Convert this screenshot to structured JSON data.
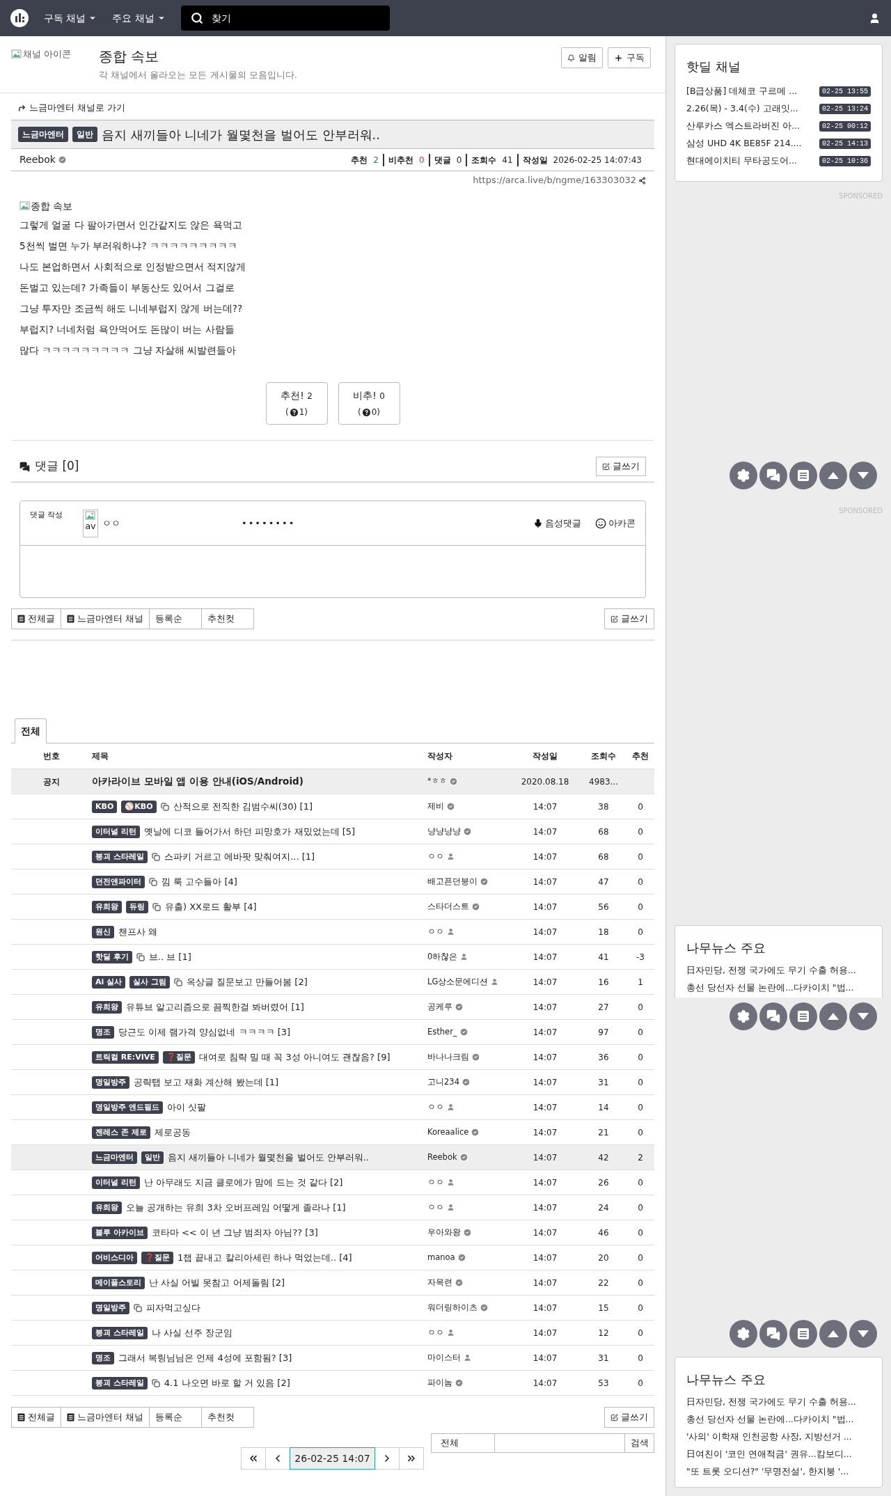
{
  "top_nav": {
    "menus": [
      {
        "label": "구독 채널"
      },
      {
        "label": "주요 채널"
      }
    ],
    "search": {
      "placeholder": "찾기"
    }
  },
  "channel": {
    "icon_alt": "채널 아이콘",
    "title": "종합 속보",
    "description": "각 채널에서 올라오는 모든 게시물의 모음입니다.",
    "buttons": [
      {
        "kind": "bell",
        "label": "알림"
      },
      {
        "kind": "plus",
        "label": "구독"
      }
    ]
  },
  "post": {
    "back_link": "느금마엔터 채널로 가기",
    "badges": [
      "느금마엔터",
      "일반"
    ],
    "title": "음지 새끼들아 니네가 월몇천을 벌어도 안부러워..",
    "author": "Reebok",
    "verified": true,
    "meta": [
      {
        "label": "추천",
        "value": "2",
        "kind": "up"
      },
      {
        "label": "비추천",
        "value": "0",
        "kind": "down"
      },
      {
        "label": "댓글",
        "value": "0",
        "kind": "plain"
      },
      {
        "label": "조회수",
        "value": "41",
        "kind": "plain"
      },
      {
        "label": "작성일",
        "value": "2026-02-25 14:07:43",
        "kind": "plain"
      }
    ],
    "url": "https://arca.live/b/ngme/163303032",
    "image_alt": "종합 속보",
    "lines": [
      "그렇게 얼굴 다 팔아가면서 인간같지도 않은 욕먹고",
      "5천씩 벌면 누가 부러워하냐? ㅋㅋㅋㅋㅋㅋㅋㅋㅋ",
      "나도 본업하면서 사회적으로 인정받으면서 적지않게",
      "돈벌고 있는데? 가족들이 부동산도 있어서 그걸로",
      "그냥 투자만 조금씩 해도 니네부럽지 않게 버는데??",
      "부럽지? 너네처럼 욕안먹어도 돈많이 버는 사람들",
      "많다 ㅋㅋㅋㅋㅋㅋㅋㅋㅋ 그냥 자살해 씨발련들아"
    ],
    "votes": [
      {
        "label": "추천!",
        "count": "2",
        "sub_open": "(",
        "sub": "1)"
      },
      {
        "label": "비추!",
        "count": "0",
        "sub_open": "(",
        "sub": "0)"
      }
    ]
  },
  "comments": {
    "title": "댓글 [0]",
    "write_button": "글쓰기",
    "form": {
      "label": "댓글 작성",
      "avatar_alt": "av",
      "name": "ㅇㅇ",
      "password": "••••••••",
      "voice": "음성댓글",
      "emoticon": "아카콘"
    }
  },
  "toolbar_top": {
    "buttons": [
      {
        "label": "전체글",
        "icon": true
      },
      {
        "label": "느금마엔터 채널",
        "icon": true
      },
      {
        "label": "등록순",
        "icon": false
      },
      {
        "label": "추천컷",
        "icon": false
      }
    ],
    "write": "글쓰기"
  },
  "board": {
    "tabs": [
      {
        "label": "전체",
        "selected": true
      }
    ],
    "columns": [
      "번호",
      "제목",
      "작성자",
      "작성일",
      "조회수",
      "추천"
    ],
    "notice": {
      "number": "공지",
      "title": "아카라이브 모바일 앱 이용 안내(iOS/Android)",
      "author": "*ㅎㅎ",
      "verified": true,
      "date": "2020.08.18",
      "views": "4983..."
    },
    "rows": [
      {
        "badges": [
          "KBO",
          "⚾KBO"
        ],
        "media": true,
        "title": "산적으로 전직한 김범수씨(30) [1]",
        "author": "제비",
        "verified": true,
        "time": "14:07",
        "views": "38",
        "votes": "0",
        "selected": false
      },
      {
        "badges": [
          "이터널 리턴"
        ],
        "media": false,
        "title": "옛날에 디코 들어가서 하던 피망호가 재밌었는데 [5]",
        "author": "냥냥냥냥",
        "verified": true,
        "time": "14:07",
        "views": "68",
        "votes": "0",
        "selected": false
      },
      {
        "badges": [
          "붕괴 스타레일"
        ],
        "media": true,
        "title": "스파키 거르고 에바팟 맞춰여지... [1]",
        "author": "ㅇㅇ",
        "verified": false,
        "time": "14:07",
        "views": "68",
        "votes": "0",
        "selected": false
      },
      {
        "badges": [
          "던전앤파이터"
        ],
        "media": true,
        "title": "낌 룩 고수들아 [4]",
        "author": "배고픈던붕이",
        "verified": true,
        "time": "14:07",
        "views": "47",
        "votes": "0",
        "selected": false
      },
      {
        "badges": [
          "유희왕",
          "듀링"
        ],
        "media": true,
        "title": "유출) XX로드 활부 [4]",
        "author": "스타더스트",
        "verified": true,
        "time": "14:07",
        "views": "56",
        "votes": "0",
        "selected": false
      },
      {
        "badges": [
          "원신"
        ],
        "media": false,
        "title": "챈프사 왜",
        "author": "ㅇㅇ",
        "verified": false,
        "time": "14:07",
        "views": "18",
        "votes": "0",
        "selected": false
      },
      {
        "badges": [
          "핫딜 후기"
        ],
        "media": true,
        "title": "브.. 브 [1]",
        "author": "0하찮은",
        "verified": false,
        "time": "14:07",
        "views": "41",
        "votes": "-3",
        "selected": false
      },
      {
        "badges": [
          "Ai 실사",
          "실사 그림"
        ],
        "media": true,
        "title": "옥상글 질문보고 만들어봄 [2]",
        "author": "LG상소문에디션",
        "verified": false,
        "time": "14:07",
        "views": "16",
        "votes": "1",
        "selected": false
      },
      {
        "badges": [
          "유희왕"
        ],
        "media": false,
        "title": "유튜브 알고리즘으로 끔찍한걸 봐버렸어 [1]",
        "author": "공케루",
        "verified": true,
        "time": "14:07",
        "views": "27",
        "votes": "0",
        "selected": false
      },
      {
        "badges": [
          "명조"
        ],
        "media": false,
        "title": "당근도 이제 램가격 양심없네 ㅋㅋㅋㅋ [3]",
        "author": "Esther_",
        "verified": true,
        "time": "14:07",
        "views": "97",
        "votes": "0",
        "selected": false
      },
      {
        "badges": [
          "트릭컬 RE:VIVE",
          "❓질문"
        ],
        "media": false,
        "title": "대여로 침략 밀 때 꼭 3성 아니여도 괜찮음? [9]",
        "author": "바나나크림",
        "verified": true,
        "time": "14:07",
        "views": "36",
        "votes": "0",
        "selected": false
      },
      {
        "badges": [
          "명일방주"
        ],
        "media": false,
        "title": "공략탭 보고 재화 계산해 봤는데 [1]",
        "author": "고니234",
        "verified": true,
        "time": "14:07",
        "views": "31",
        "votes": "0",
        "selected": false
      },
      {
        "badges": [
          "명일방주 엔드필드"
        ],
        "media": false,
        "title": "아이 싯팔",
        "author": "ㅇㅇ",
        "verified": false,
        "time": "14:07",
        "views": "14",
        "votes": "0",
        "selected": false
      },
      {
        "badges": [
          "젠레스 존 제로"
        ],
        "media": false,
        "title": "제로공동",
        "author": "Koreaalice",
        "verified": true,
        "time": "14:07",
        "views": "21",
        "votes": "0",
        "selected": false
      },
      {
        "badges": [
          "느금마엔터",
          "일반"
        ],
        "media": false,
        "title": "음지 새끼들아 니네가 월몇천을 벌어도 안부러워..",
        "author": "Reebok",
        "verified": true,
        "time": "14:07",
        "views": "42",
        "votes": "2",
        "selected": true
      },
      {
        "badges": [
          "이터널 리턴"
        ],
        "media": false,
        "title": "난 아무래도 지금 클로에가 맘에 드는 것 같다 [2]",
        "author": "ㅇㅇ",
        "verified": false,
        "time": "14:07",
        "views": "26",
        "votes": "0",
        "selected": false
      },
      {
        "badges": [
          "유희왕"
        ],
        "media": false,
        "title": "오늘 공개하는 유희 3차 오버프레임 어떻게 졸라나 [1]",
        "author": "ㅇㅇ",
        "verified": false,
        "time": "14:07",
        "views": "24",
        "votes": "0",
        "selected": false
      },
      {
        "badges": [
          "블루 아카이브"
        ],
        "media": false,
        "title": "코타마 << 이 년 그냥 범죄자 아님?? [3]",
        "author": "우아와왕",
        "verified": true,
        "time": "14:07",
        "views": "46",
        "votes": "0",
        "selected": false
      },
      {
        "badges": [
          "어비스디아",
          "❓질문"
        ],
        "media": false,
        "title": "1챕 끝내고 칼리아세린 하나 먹었는데.. [4]",
        "author": "manoa",
        "verified": true,
        "time": "14:07",
        "views": "20",
        "votes": "0",
        "selected": false
      },
      {
        "badges": [
          "메이플스토리"
        ],
        "media": false,
        "title": "난 사실 어빌 못참고 어제돌림 [2]",
        "author": "자목련",
        "verified": true,
        "time": "14:07",
        "views": "22",
        "votes": "0",
        "selected": false
      },
      {
        "badges": [
          "명일방주"
        ],
        "media": true,
        "title": "피자먹고싶다",
        "author": "워더링하이츠",
        "verified": true,
        "time": "14:07",
        "views": "15",
        "votes": "0",
        "selected": false
      },
      {
        "badges": [
          "붕괴 스타레일"
        ],
        "media": false,
        "title": "나 사실 선주 장군임",
        "author": "ㅇㅇ",
        "verified": false,
        "time": "14:07",
        "views": "12",
        "votes": "0",
        "selected": false
      },
      {
        "badges": [
          "명조"
        ],
        "media": false,
        "title": "그래서 복링님님은 언제 4성에 포함됨? [3]",
        "author": "마이스터",
        "verified": false,
        "time": "14:07",
        "views": "31",
        "votes": "0",
        "selected": false
      },
      {
        "badges": [
          "붕괴 스타레일"
        ],
        "media": true,
        "title": "4.1 나오면 바로 할 거 있음 [2]",
        "author": "파이놈",
        "verified": true,
        "time": "14:07",
        "views": "53",
        "votes": "0",
        "selected": false
      }
    ]
  },
  "toolbar_bottom": {
    "buttons": [
      {
        "label": "전체글",
        "icon": true
      },
      {
        "label": "느금마엔터 채널",
        "icon": true
      },
      {
        "label": "등록순",
        "icon": false
      },
      {
        "label": "추천컷",
        "icon": false
      }
    ],
    "write": "글쓰기"
  },
  "search": {
    "scope": "전체",
    "button": "검색"
  },
  "pagination": [
    {
      "kind": "first",
      "selected": false
    },
    {
      "kind": "prev",
      "selected": false
    },
    {
      "kind": "current",
      "label": "26-02-25 14:07",
      "selected": true
    },
    {
      "kind": "next",
      "selected": false
    },
    {
      "kind": "last",
      "selected": false
    }
  ],
  "sidebar": {
    "hotdeal": {
      "title": "핫딜 채널",
      "items": [
        {
          "title": "[B급상품] 데체코 구르메 ...",
          "time": "02-25 13:55"
        },
        {
          "title": "2.26(목) - 3.4(수) 고래잇...",
          "time": "02-25 13:24"
        },
        {
          "title": "산루카스 엑스트라버진 아...",
          "time": "02-25 00:12"
        },
        {
          "title": "삼성 UHD 4K BE85F 214....",
          "time": "02-25 14:13"
        },
        {
          "title": "현대에이치티 무타공도어...",
          "time": "02-25 10:36"
        }
      ]
    },
    "sponsored": [
      "SPONSORED",
      "SPONSORED"
    ],
    "news": [
      {
        "title": "나무뉴스 주요",
        "items": [
          "日자민당, 전쟁 국가에도 무기 수출 허용...",
          "총선 당선자 선물 논란에...다카이치 \"법..."
        ]
      },
      {
        "title": "나무뉴스 주요",
        "items": [
          "日자민당, 전쟁 국가에도 무기 수출 허용...",
          "총선 당선자 선물 논란에...다카이치 \"법...",
          "'사의' 이학재 인천공항 사장, 지방선거 ...",
          "日여친이 '코인 연애적금' 권유...캄보디...",
          "\"또 트롯 오디션?\" '무명전설', 한지붕 '..."
        ]
      }
    ]
  }
}
